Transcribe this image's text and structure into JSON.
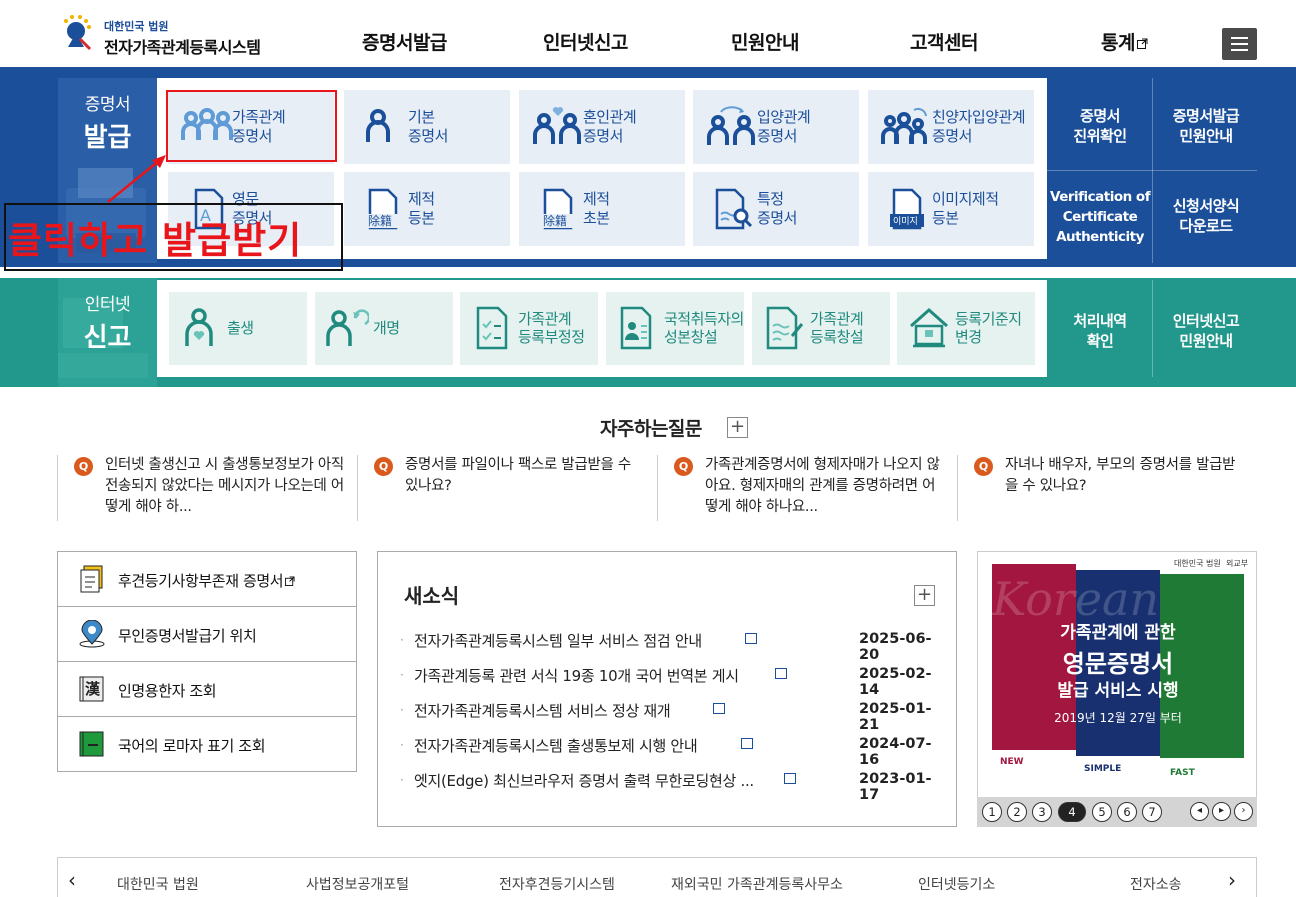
{
  "header": {
    "logo_small": "대한민국 법원",
    "logo_title": "전자가족관계등록시스템",
    "nav": [
      "증명서발급",
      "인터넷신고",
      "민원안내",
      "고객센터",
      "통계"
    ]
  },
  "issuance": {
    "title_small": "증명서",
    "title_big": "발급",
    "tiles": [
      {
        "label": "가족관계\n증명서",
        "icon": "three-people-icon"
      },
      {
        "label": "기본\n증명서",
        "icon": "person-icon"
      },
      {
        "label": "혼인관계\n증명서",
        "icon": "couple-heart-icon"
      },
      {
        "label": "입양관계\n증명서",
        "icon": "adoption-arrows-icon"
      },
      {
        "label": "친양자입양관계\n증명서",
        "icon": "family-arrows-icon"
      },
      {
        "label": "영문\n증명서",
        "icon": "english-doc-icon"
      },
      {
        "label": "제적\n등본",
        "icon": "removal-doc-icon",
        "badge": "除籍"
      },
      {
        "label": "제적\n초본",
        "icon": "removal-abstract-icon",
        "badge": "除籍"
      },
      {
        "label": "특정\n증명서",
        "icon": "magnifier-doc-icon"
      },
      {
        "label": "이미지제적\n등본",
        "icon": "image-doc-icon",
        "badge": "이미지"
      }
    ],
    "right": [
      "증명서\n진위확인",
      "증명서발급\n민원안내",
      "Verification of\nCertificate\nAuthenticity",
      "신청서양식\n다운로드"
    ]
  },
  "report": {
    "title_small": "인터넷",
    "title_big": "신고",
    "tiles": [
      {
        "label": "출생",
        "icon": "birth-icon"
      },
      {
        "label": "개명",
        "icon": "rename-icon"
      },
      {
        "label": "가족관계\n등록부정정",
        "icon": "checklist-doc-icon"
      },
      {
        "label": "국적취득자의\n성본창설",
        "icon": "nationality-doc-icon"
      },
      {
        "label": "가족관계\n등록창설",
        "icon": "register-doc-icon"
      },
      {
        "label": "등록기준지\n변경",
        "icon": "house-icon"
      }
    ],
    "right": [
      "처리내역\n확인",
      "인터넷신고\n민원안내"
    ]
  },
  "annotation": {
    "text": "클릭하고 발급받기"
  },
  "faq": {
    "title": "자주하는질문",
    "plus": "+",
    "items": [
      "인터넷 출생신고 시 출생통보정보가 아직 전송되지 않았다는 메시지가 나오는데 어떻게 해야 하...",
      "증명서를 파일이나 팩스로 발급받을 수 있나요?",
      "가족관계증명서에 형제자매가 나오지 않아요. 형제자매의 관계를 증명하려면 어떻게 해야 하나요...",
      "자녀나 배우자, 부모의 증명서를 발급받을 수 있나요?"
    ]
  },
  "quick_links": [
    {
      "label": "후견등기사항부존재 증명서",
      "icon": "document-icon"
    },
    {
      "label": "무인증명서발급기 위치",
      "icon": "location-pin-icon"
    },
    {
      "label": "인명용한자 조회",
      "icon": "hanja-book-icon",
      "glyph": "漢"
    },
    {
      "label": "국어의 로마자 표기 조회",
      "icon": "green-book-icon"
    }
  ],
  "news": {
    "title": "새소식",
    "plus": "+",
    "items": [
      {
        "title": "전자가족관계등록시스템 일부 서비스 점검 안내",
        "date": "2025-06-20"
      },
      {
        "title": "가족관계등록 관련 서식 19종 10개 국어 번역본 게시",
        "date": "2025-02-14"
      },
      {
        "title": "전자가족관계등록시스템 서비스 정상 재개",
        "date": "2025-01-21"
      },
      {
        "title": "전자가족관계등록시스템 출생통보제 시행 안내",
        "date": "2024-07-16"
      },
      {
        "title": "엣지(Edge) 최신브라우저 증명서 출력 무한로딩현상 ...",
        "date": "2023-01-17"
      }
    ]
  },
  "banner": {
    "org1": "대한민국 법원",
    "org2": "외교부",
    "watermark": "Korean",
    "line1": "가족관계에 관한",
    "line2": "영문증명서",
    "line3": "발급 서비스 시행",
    "date": "2019년 12월 27일 부터",
    "col1": "NEW",
    "col2": "SIMPLE",
    "col3": "FAST",
    "colors": {
      "red": "#a3163f",
      "navy": "#18306f",
      "green": "#1e7a34"
    },
    "pages": [
      "1",
      "2",
      "3",
      "4",
      "5",
      "6",
      "7"
    ],
    "active_page": "4"
  },
  "footer": {
    "links": [
      "대한민국 법원",
      "사법정보공개포털",
      "전자후견등기시스템",
      "재외국민 가족관계등록사무소",
      "인터넷등기소",
      "전자소송"
    ]
  }
}
